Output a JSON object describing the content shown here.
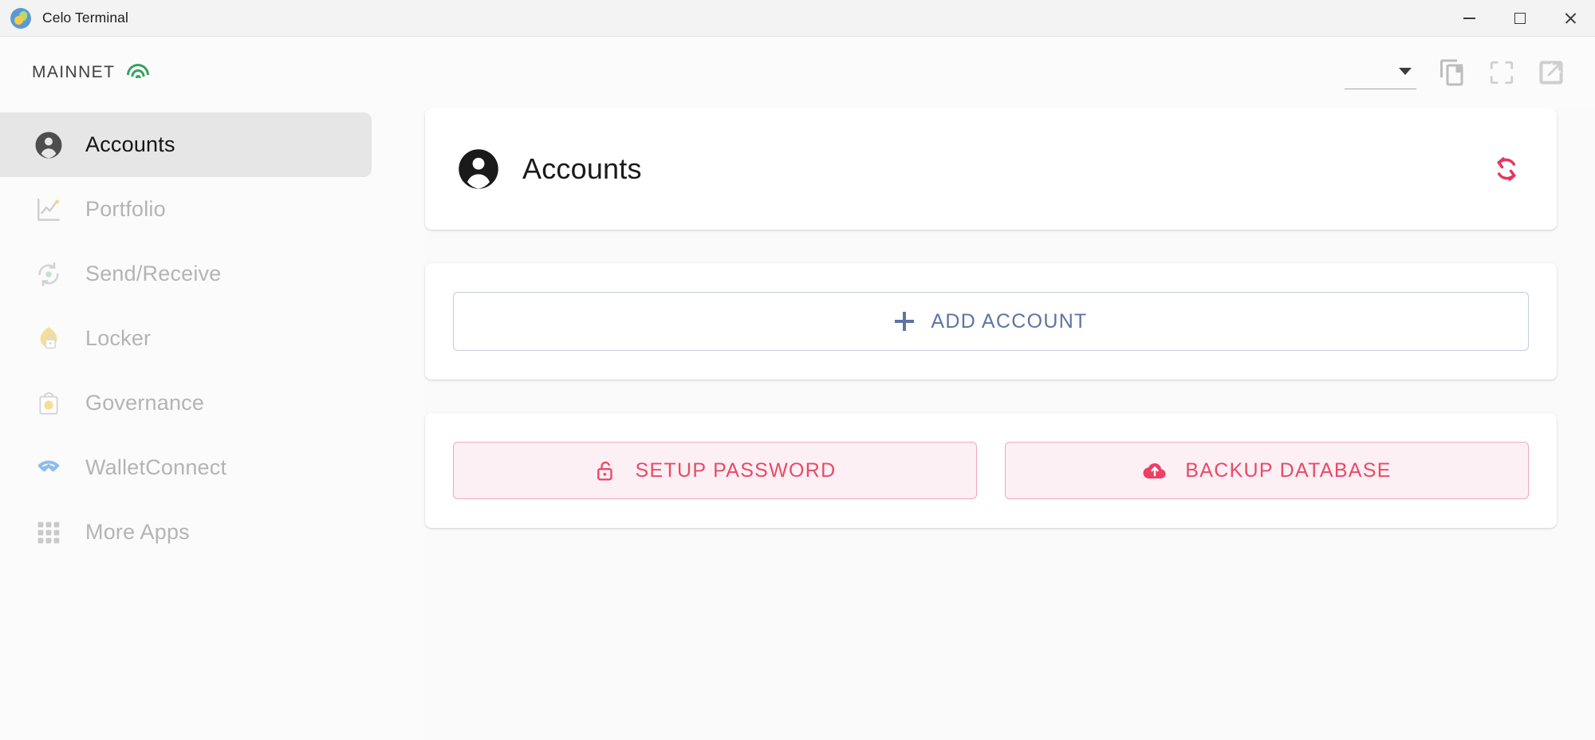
{
  "window": {
    "title": "Celo Terminal",
    "logo_icon": "celo-logo-icon",
    "minimize_label": "Minimize",
    "maximize_label": "Maximize",
    "close_label": "Close"
  },
  "appbar": {
    "network": "MAINNET",
    "network_status_icon": "wifi-icon",
    "network_status_color": "#3aa061",
    "select_value": "",
    "icons": [
      {
        "name": "copy-icon",
        "label": "Copy"
      },
      {
        "name": "fullscreen-icon",
        "label": "Fullscreen"
      },
      {
        "name": "open-external-icon",
        "label": "Open External"
      }
    ]
  },
  "sidebar": {
    "items": [
      {
        "label": "Accounts",
        "icon": "person-icon",
        "active": true
      },
      {
        "label": "Portfolio",
        "icon": "line-chart-icon",
        "active": false
      },
      {
        "label": "Send/Receive",
        "icon": "exchange-icon",
        "active": false
      },
      {
        "label": "Locker",
        "icon": "locker-icon",
        "active": false
      },
      {
        "label": "Governance",
        "icon": "ballot-icon",
        "active": false
      },
      {
        "label": "WalletConnect",
        "icon": "walletconnect-icon",
        "active": false
      },
      {
        "label": "More Apps",
        "icon": "apps-grid-icon",
        "active": false
      }
    ]
  },
  "main": {
    "header": {
      "title": "Accounts",
      "icon": "person-icon",
      "refresh_icon": "refresh-icon",
      "refresh_color": "#e8365a"
    },
    "add_account": {
      "label": "ADD ACCOUNT",
      "icon": "plus-icon",
      "color": "#5d74a3"
    },
    "actions": [
      {
        "label": "SETUP PASSWORD",
        "icon": "unlock-icon",
        "color": "#e94968"
      },
      {
        "label": "BACKUP DATABASE",
        "icon": "cloud-upload-icon",
        "color": "#e94968"
      }
    ]
  }
}
